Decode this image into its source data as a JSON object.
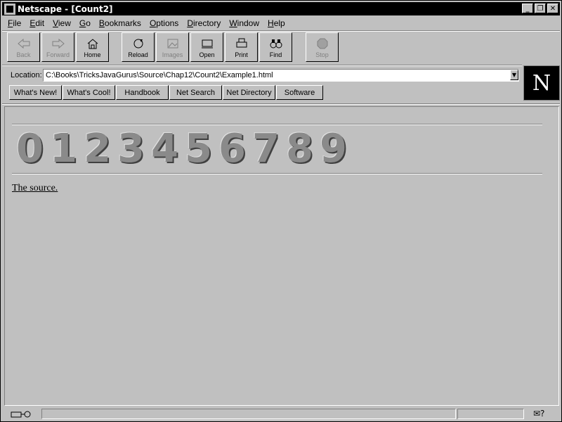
{
  "window": {
    "title": "Netscape - [Count2]"
  },
  "menu": [
    {
      "label": "File",
      "acc": "F",
      "rest": "ile"
    },
    {
      "label": "Edit",
      "acc": "E",
      "rest": "dit"
    },
    {
      "label": "View",
      "acc": "V",
      "rest": "iew"
    },
    {
      "label": "Go",
      "acc": "G",
      "rest": "o"
    },
    {
      "label": "Bookmarks",
      "acc": "B",
      "rest": "ookmarks"
    },
    {
      "label": "Options",
      "acc": "O",
      "rest": "ptions"
    },
    {
      "label": "Directory",
      "acc": "D",
      "rest": "irectory"
    },
    {
      "label": "Window",
      "acc": "W",
      "rest": "indow"
    },
    {
      "label": "Help",
      "acc": "H",
      "rest": "elp"
    }
  ],
  "toolbar": {
    "back": "Back",
    "forward": "Forward",
    "home": "Home",
    "reload": "Reload",
    "images": "Images",
    "open": "Open",
    "print": "Print",
    "find": "Find",
    "stop": "Stop"
  },
  "location": {
    "label": "Location:",
    "value": "C:\\Books\\TricksJavaGurus\\Source\\Chap12\\Count2\\Example1.html"
  },
  "directory_buttons": [
    "What's New!",
    "What's Cool!",
    "Handbook",
    "Net Search",
    "Net Directory",
    "Software"
  ],
  "logo": {
    "letter": "N"
  },
  "content": {
    "digits": [
      "0",
      "1",
      "2",
      "3",
      "4",
      "5",
      "6",
      "7",
      "8",
      "9"
    ],
    "link_text": "The source."
  },
  "statusbar": {
    "text": ""
  }
}
